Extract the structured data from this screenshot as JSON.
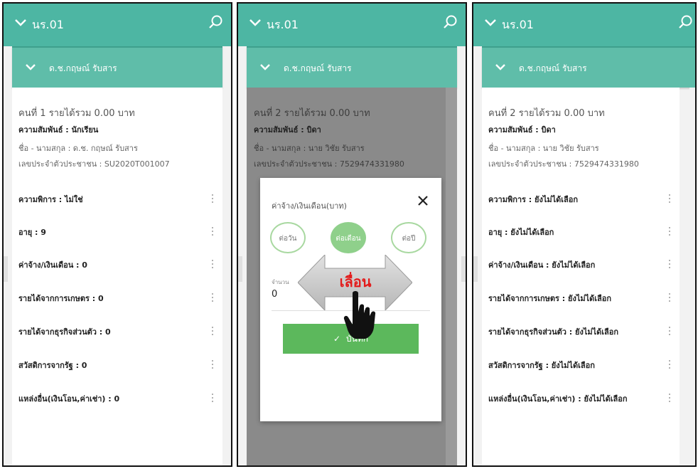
{
  "app": {
    "title": "นร.01",
    "section_title": "ด.ช.กฤษณ์ รับสาร"
  },
  "colors": {
    "topbar": "#4db6a3",
    "section": "#5fbda9",
    "accent_green": "#5cb85c",
    "swipe_red": "#e31b1b"
  },
  "panel1": {
    "header": "คนที่ 1 รายได้รวม 0.00 บาท",
    "relation": "ความสัมพันธ์ : นักเรียน",
    "name": "ชื่อ - นามสกุล : ด.ช. กฤษณ์ รับสาร",
    "id": "เลขประจำตัวประชาชน : SU2020T001007",
    "items": [
      "ความพิการ : ไม่ใช่",
      "อายุ : 9",
      "ค่าจ้าง/เงินเดือน : 0",
      "รายได้จากการเกษตร : 0",
      "รายได้จากธุรกิจส่วนตัว : 0",
      "สวัสดิการจากรัฐ : 0",
      "แหล่งอื่น(เงินโอน,ค่าเช่า) : 0"
    ]
  },
  "panel2": {
    "header": "คนที่ 2 รายได้รวม 0.00 บาท",
    "relation": "ความสัมพันธ์ : บิดา",
    "name": "ชื่อ - นามสกุล : นาย วิชัย รับสาร",
    "id": "เลขประจำตัวประชาชน : 7529474331980",
    "dialog": {
      "title": "ค่าจ้าง/เงินเดือน(บาท)",
      "options": [
        "ต่อวัน",
        "ต่อเดือน",
        "ต่อปี"
      ],
      "selected": "ต่อเดือน",
      "field_label": "จำนวน",
      "value": "0",
      "save_label": "บันทึก"
    },
    "swipe_label": "เลื่อน"
  },
  "panel3": {
    "header": "คนที่ 2 รายได้รวม 0.00 บาท",
    "relation": "ความสัมพันธ์ : บิดา",
    "name": "ชื่อ - นามสกุล : นาย วิชัย รับสาร",
    "id": "เลขประจำตัวประชาชน : 7529474331980",
    "items": [
      "ความพิการ : ยังไม่ได้เลือก",
      "อายุ : ยังไม่ได้เลือก",
      "ค่าจ้าง/เงินเดือน : ยังไม่ได้เลือก",
      "รายได้จากการเกษตร : ยังไม่ได้เลือก",
      "รายได้จากธุรกิจส่วนตัว : ยังไม่ได้เลือก",
      "สวัสดิการจากรัฐ : ยังไม่ได้เลือก",
      "แหล่งอื่น(เงินโอน,ค่าเช่า) : ยังไม่ได้เลือก"
    ]
  }
}
